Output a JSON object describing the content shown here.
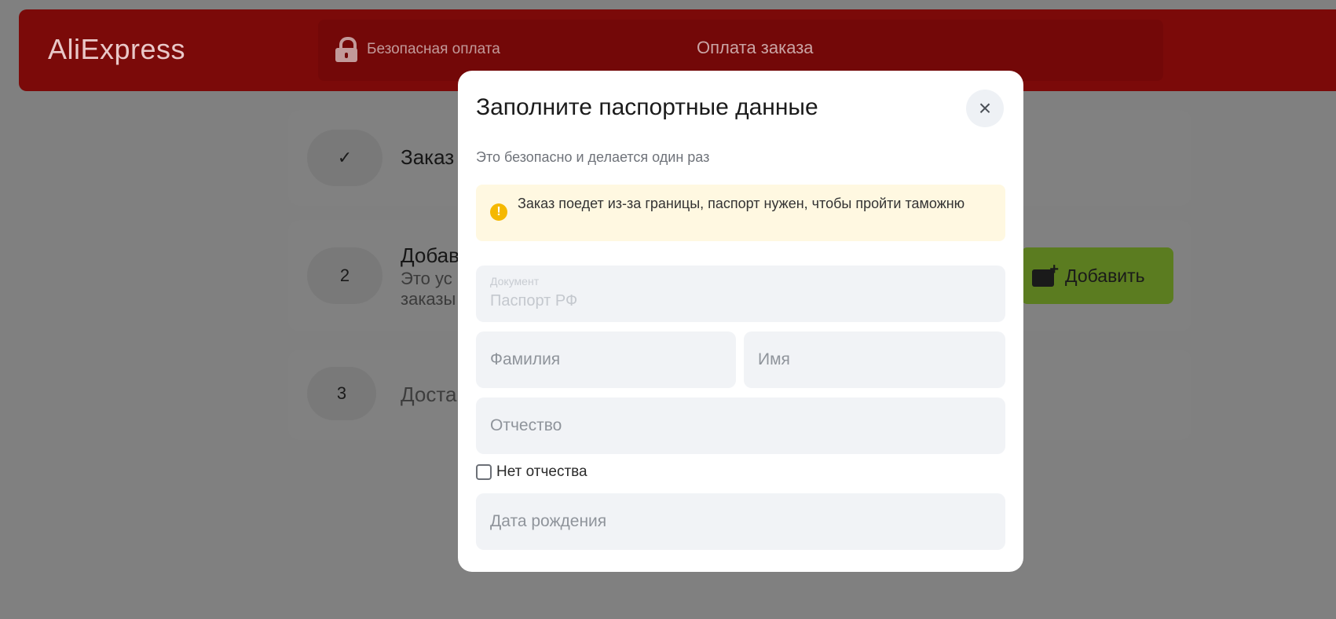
{
  "header": {
    "logo": "AliExpress",
    "secure_label": "Безопасная оплата",
    "order_title": "Оплата заказа"
  },
  "steps": [
    {
      "marker": "✓",
      "title": "Заказ",
      "subtitle": ""
    },
    {
      "marker": "2",
      "title": "Добав",
      "subtitle_line1": "Это ус",
      "subtitle_line2": "заказы",
      "button_label": "Добавить"
    },
    {
      "marker": "3",
      "title": "Доста",
      "subtitle": ""
    }
  ],
  "modal": {
    "title": "Заполните паспортные данные",
    "close_icon": "×",
    "subtitle": "Это безопасно и делается один раз",
    "notice": {
      "icon": "!",
      "text": "Заказ поедет из-за границы, паспорт нужен, чтобы пройти таможню"
    },
    "document": {
      "label": "Документ",
      "value": "Паспорт РФ"
    },
    "last_name": {
      "placeholder": "Фамилия"
    },
    "first_name": {
      "placeholder": "Имя"
    },
    "middle_name": {
      "placeholder": "Отчество"
    },
    "no_middle_name": {
      "label": "Нет отчества",
      "checked": false
    },
    "birth_date": {
      "placeholder": "Дата рождения"
    }
  },
  "colors": {
    "overlay": "#808080",
    "header_red": "#7b0a09",
    "add_button_green": "#5b7c20",
    "notice_bg": "#fff8e1",
    "notice_icon": "#f5b800",
    "field_bg": "#f1f3f6"
  }
}
